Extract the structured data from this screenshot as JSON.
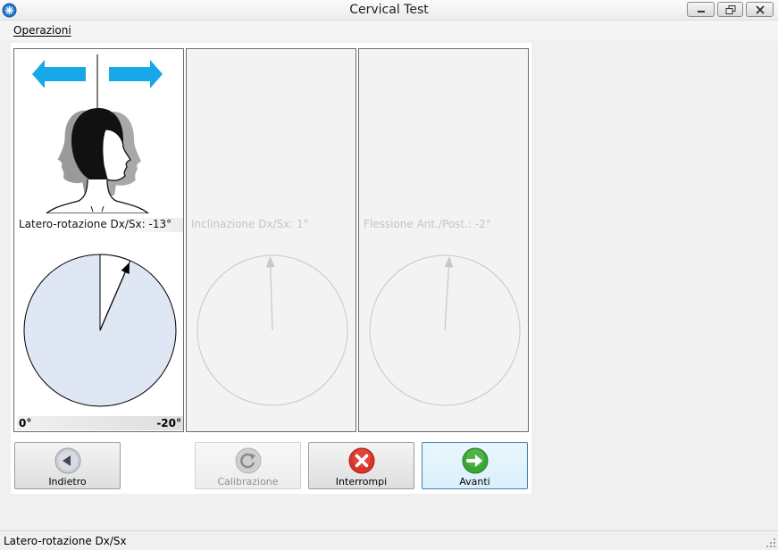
{
  "window": {
    "title": "Cervical Test"
  },
  "menu": {
    "items": [
      {
        "label": "Operazioni"
      }
    ]
  },
  "panels": [
    {
      "reading": "Latero-rotazione Dx/Sx: -13°",
      "angle_deg": -13,
      "target_deg": -20,
      "scale_min": "0°",
      "scale_max": "-20°",
      "enabled": true
    },
    {
      "reading": "Inclinazione Dx/Sx: 1°",
      "angle_deg": 1,
      "enabled": false
    },
    {
      "reading": "Flessione Ant./Post.: -2°",
      "angle_deg": -2,
      "enabled": false
    }
  ],
  "buttons": {
    "back": {
      "label": "Indietro",
      "icon": "arrow-left-icon"
    },
    "calibrate": {
      "label": "Calibrazione",
      "icon": "refresh-icon"
    },
    "stop": {
      "label": "Interrompi",
      "icon": "stop-x-icon"
    },
    "next": {
      "label": "Avanti",
      "icon": "arrow-right-icon"
    }
  },
  "status": {
    "text": "Latero-rotazione Dx/Sx"
  },
  "colors": {
    "dial_fill": "#dfe6f4",
    "arrow_blue": "#16a8e8",
    "stop_red": "#d9332a",
    "next_green": "#3aa634",
    "disabled_gray": "#c8c8c8"
  }
}
